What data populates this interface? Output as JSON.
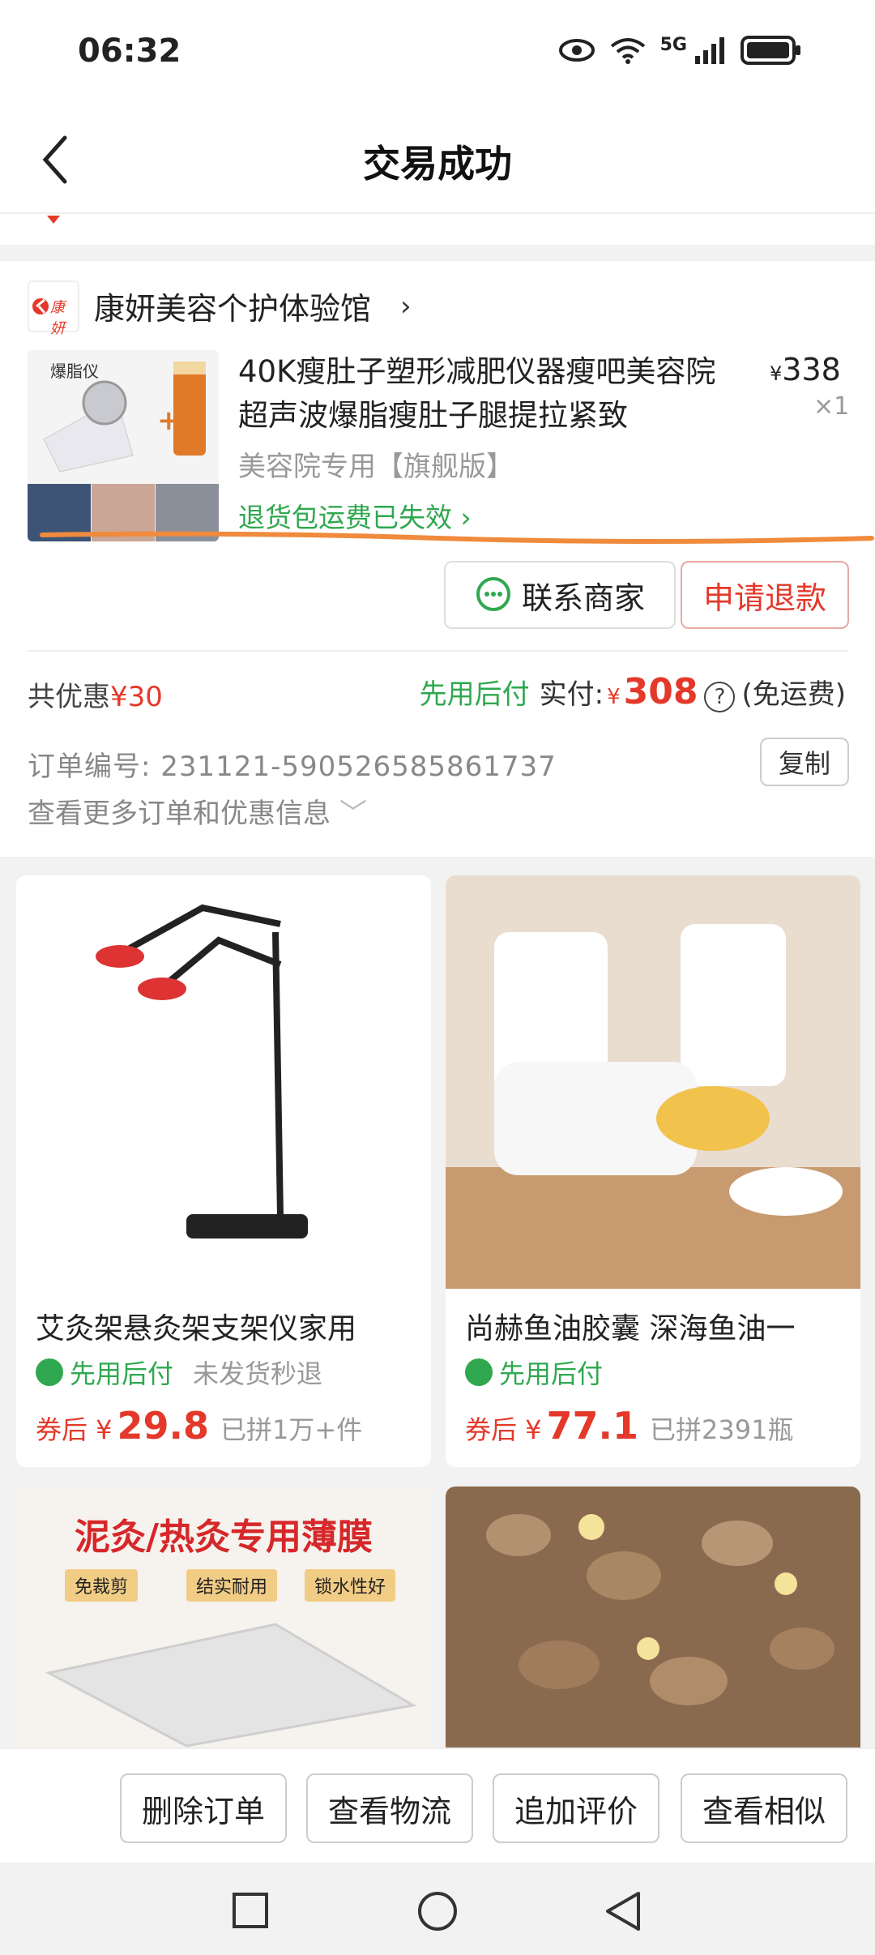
{
  "status_bar": {
    "time": "06:32",
    "network": "5G"
  },
  "header": {
    "title": "交易成功"
  },
  "order": {
    "shop_name": "康妍美容个护体验馆",
    "shop_logo_text": "康妍",
    "product": {
      "title": "40K瘦肚子塑形减肥仪器瘦吧美容院超声波爆脂瘦肚子腿提拉紧致",
      "image_caption": "爆脂仪",
      "price_symbol": "¥",
      "price": "338",
      "quantity": "×1",
      "spec": "美容院专用【旗舰版】",
      "refund_note": "退货包运费已失效"
    },
    "buttons": {
      "contact": "联系商家",
      "refund": "申请退款"
    },
    "discount_label": "共优惠",
    "discount_value": "¥30",
    "pay_later": "先用后付",
    "paid_label": "实付:",
    "paid_symbol": "¥",
    "paid_amount": "308",
    "help_icon": "?",
    "shipping": "(免运费)",
    "order_no_label": "订单编号:",
    "order_no": "231121-590526585861737",
    "copy": "复制",
    "more_info": "查看更多订单和优惠信息"
  },
  "recommendations": [
    {
      "title": "艾灸架悬灸架支架仪家用",
      "tag": "先用后付",
      "extra_tag": "未发货秒退",
      "price_prefix": "券后 ¥",
      "price": "29.8",
      "sold": "已拼1万+件"
    },
    {
      "title": "尚赫鱼油胶囊 深海鱼油一",
      "tag": "先用后付",
      "extra_tag": "",
      "price_prefix": "券后 ¥",
      "price": "77.1",
      "sold": "已拼2391瓶"
    },
    {
      "banner_title": "泥灸/热灸专用薄膜",
      "chips": [
        "免裁剪",
        "结实耐用",
        "锁水性好"
      ]
    },
    {
      "title": ""
    }
  ],
  "actions": [
    "删除订单",
    "查看物流",
    "追加评价",
    "查看相似"
  ],
  "colors": {
    "red": "#e4392a",
    "green": "#2fa84f",
    "annotation": "#f08a3c"
  }
}
